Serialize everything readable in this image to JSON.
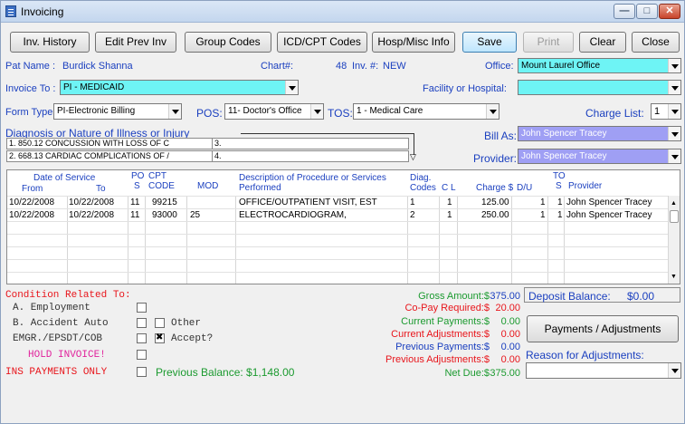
{
  "window": {
    "title": "Invoicing",
    "controls": {
      "minimize": "—",
      "maximize": "□",
      "close": "✕"
    }
  },
  "toolbar": {
    "inv_history": "Inv. History",
    "edit_prev_inv": "Edit Prev Inv",
    "group_codes": "Group Codes",
    "icd_cpt_codes": "ICD/CPT Codes",
    "hosp_misc_info": "Hosp/Misc Info",
    "save": "Save",
    "print": "Print",
    "clear": "Clear",
    "close": "Close"
  },
  "patient": {
    "name_label": "Pat Name :",
    "name_value": "Burdick Shanna",
    "chart_label": "Chart#:",
    "chart_value": "48",
    "inv_label": "Inv. #:",
    "inv_value": "NEW",
    "office_label": "Office:",
    "office_value": "Mount Laurel Office",
    "invoice_to_label": "Invoice To :",
    "invoice_to_value": "PI - MEDICAID",
    "facility_label": "Facility or Hospital:",
    "facility_value": "",
    "form_type_label": "Form Type:",
    "form_type_value": "PI-Electronic Billing",
    "pos_label": "POS:",
    "pos_value": "11- Doctor's Office",
    "tos_label": "TOS:",
    "tos_value": "1 - Medical Care",
    "charge_list_label": "Charge List:",
    "charge_list_value": "1"
  },
  "diagnosis": {
    "heading": "Diagnosis or Nature of Illness or Injury",
    "items": [
      {
        "text": "1.  850.12    CONCUSSION WITH LOSS OF C"
      },
      {
        "text": "3."
      },
      {
        "text": "2.  668.13    CARDIAC COMPLICATIONS OF /"
      },
      {
        "text": "4."
      }
    ],
    "bill_as_label": "Bill As:",
    "bill_as_value": "John Spencer Tracey",
    "provider_label": "Provider:",
    "provider_value": "John Spencer Tracey"
  },
  "grid": {
    "headers": {
      "date_of_service": "Date of Service",
      "from": "From",
      "to": "To",
      "pos1": "PO",
      "pos2": "S",
      "cpt1": "CPT",
      "cpt2": "CODE",
      "mod": "MOD",
      "desc1": "Description of Procedure or Services",
      "desc2": "Performed",
      "diag1": "Diag.",
      "diag2": "Codes",
      "cl": "C L",
      "charge": "Charge $",
      "du": "D/U",
      "tos1": "TO",
      "tos2": "S",
      "provider": "Provider"
    },
    "rows": [
      {
        "from": "10/22/2008",
        "to": "10/22/2008",
        "pos": "11",
        "cpt": "99215",
        "mod": "",
        "desc": "OFFICE/OUTPATIENT VISIT, EST",
        "diag": "1",
        "cl": "1",
        "charge": "125.00",
        "du": "1",
        "tos": "1",
        "provider": "John Spencer Tracey"
      },
      {
        "from": "10/22/2008",
        "to": "10/22/2008",
        "pos": "11",
        "cpt": "93000",
        "mod": "25",
        "desc": "ELECTROCARDIOGRAM,",
        "diag": "2",
        "cl": "1",
        "charge": "250.00",
        "du": "1",
        "tos": "1",
        "provider": "John Spencer Tracey"
      }
    ]
  },
  "condition": {
    "heading": "Condition Related To:",
    "employment": "A. Employment",
    "accident": "B. Accident Auto",
    "other": "Other",
    "emgr": "EMGR./EPSDT/COB",
    "accept": "Accept?",
    "hold": "HOLD INVOICE!",
    "ins_only": "INS PAYMENTS ONLY",
    "previous_balance": "Previous Balance: $1,148.00"
  },
  "totals": {
    "gross_label": "Gross Amount:$",
    "gross_value": "375.00",
    "copay_label": "Co-Pay Required:$",
    "copay_value": "20.00",
    "cur_pay_label": "Current Payments:$",
    "cur_pay_value": "0.00",
    "cur_adj_label": "Current Adjustments:$",
    "cur_adj_value": "0.00",
    "prev_pay_label": "Previous Payments:$",
    "prev_pay_value": "0.00",
    "prev_adj_label": "Previous Adjustments:$",
    "prev_adj_value": "0.00",
    "net_label": "Net Due:$",
    "net_value": "375.00"
  },
  "deposit": {
    "label": "Deposit Balance:",
    "value": "$0.00"
  },
  "payments_button": "Payments / Adjustments",
  "reason_label": "Reason for Adjustments:",
  "colors": {
    "cyan_field": "#6ef4f5",
    "purple_field": "#9f9ff4",
    "label_blue": "#1a3fbf",
    "red": "#e8151b",
    "green": "#1b9a2f"
  }
}
